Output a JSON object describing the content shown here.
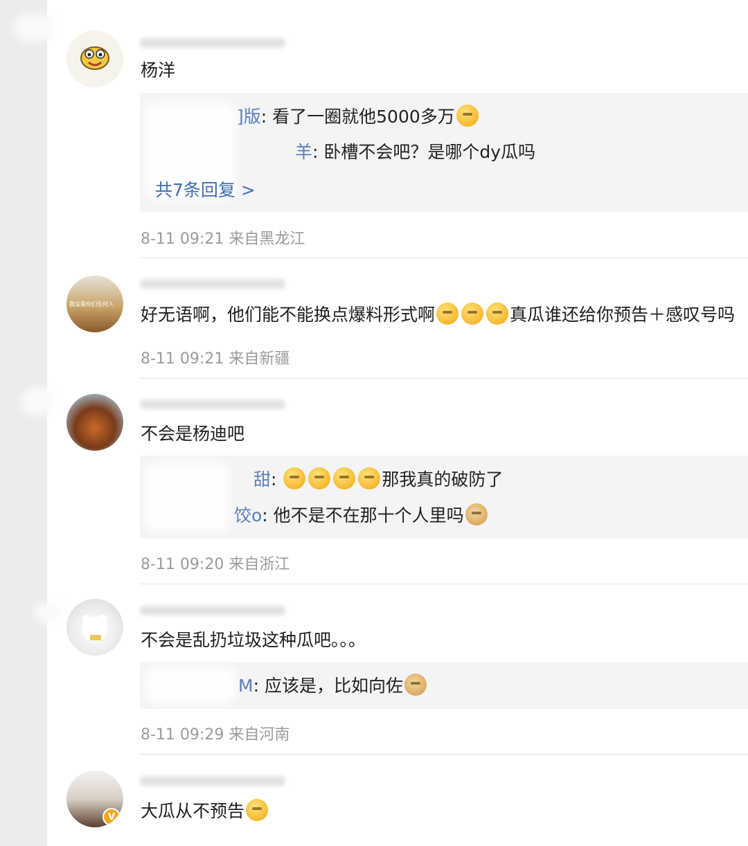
{
  "comments": [
    {
      "text": "杨洋",
      "replies": [
        {
          "user_fragment": "]版",
          "text": ": 看了一圈就他5000多万",
          "emoji": "shush-face"
        },
        {
          "user_fragment": "羊",
          "text": ": 卧槽不会吧？是哪个dy瓜吗",
          "emoji": ""
        }
      ],
      "more_replies": "共7条回复 >",
      "meta": "8-11 09:21 来自黑龙江"
    },
    {
      "avatar_caption": "我没看你们任何人",
      "text_before": "好无语啊，他们能不能换点爆料形式啊",
      "text_after": "真瓜谁还给你预告＋感叹号吗",
      "meta": "8-11 09:21 来自新疆"
    },
    {
      "text": "不会是杨迪吧",
      "replies": [
        {
          "user_fragment": "甜",
          "text_before": ": ",
          "text": "那我真的破防了"
        },
        {
          "user_fragment": "饺o",
          "text": ": 他不是不在那十个人里吗"
        }
      ],
      "meta": "8-11 09:20 来自浙江"
    },
    {
      "text": "不会是乱扔垃圾这种瓜吧。。。",
      "replies": [
        {
          "user_fragment": "M",
          "text": ": 应该是，比如向佐"
        }
      ],
      "meta": "8-11 09:29 来自河南"
    },
    {
      "text": "大瓜从不预告",
      "verify_badge": "V"
    }
  ],
  "colors": {
    "reply_user": "#5b7fb8",
    "more_replies_link": "#3f6eb5",
    "meta_text": "#9a9a9a",
    "reply_bg": "#f4f4f6"
  }
}
